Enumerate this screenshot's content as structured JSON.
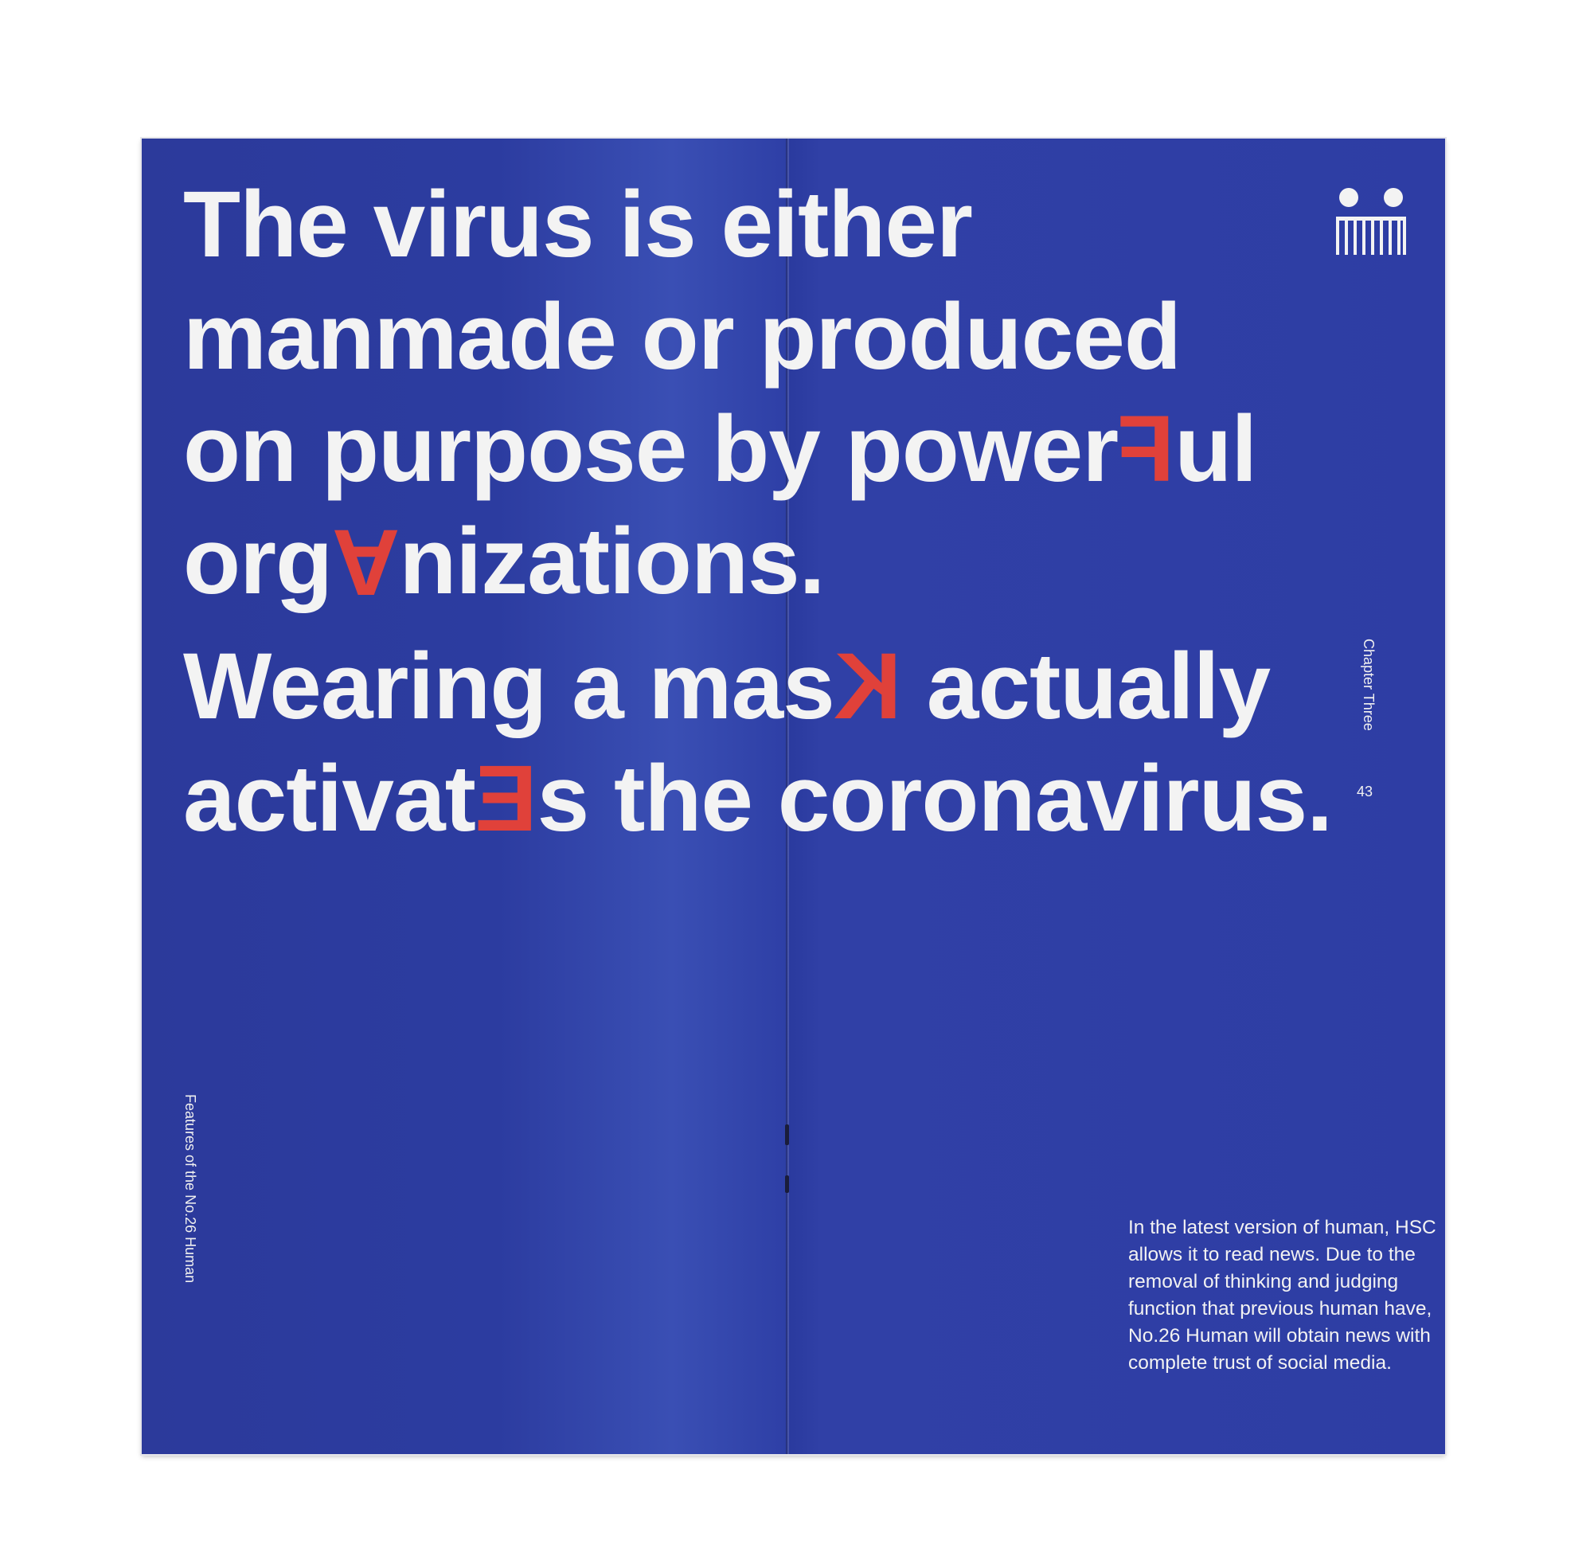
{
  "headline": {
    "l1": "The virus is either",
    "l2": "manmade or produced",
    "l3_pre": "on purpose by power",
    "l3_red": "F",
    "l3_post": "ul",
    "l4_pre": "org",
    "l4_red": "A",
    "l4_post": "nizations.",
    "l5_pre": "Wearing a mas",
    "l5_red": "K",
    "l5_post": " actually",
    "l6_pre": "activat",
    "l6_red": "E",
    "l6_post": "s the coronavirus."
  },
  "chapter_label": "Chapter Three",
  "page_number": "43",
  "footer_label": "Features of the No.26 Human",
  "body_text": "In the latest version of human, HSC allows it to read news. Due to the removal of  thinking and judging function that previous human have, No.26 Human will obtain news with complete trust of social media.",
  "colors": {
    "page": "#2a3a9c",
    "accent": "#e0413a",
    "text": "#f3f3f3"
  },
  "logo_icon": "dots-and-bars-logo"
}
